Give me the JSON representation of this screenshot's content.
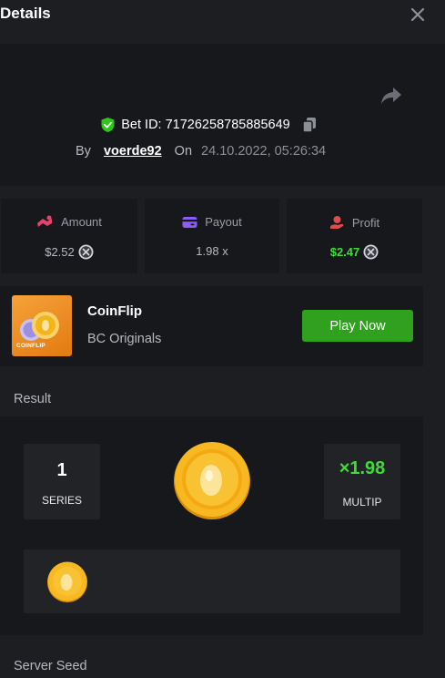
{
  "header": {
    "title": "Details",
    "close_icon": "close-icon"
  },
  "bet": {
    "id_label": "Bet ID: 71726258785885649",
    "by_label": "By",
    "username": "voerde92",
    "on_label": "On",
    "datetime": "24.10.2022, 05:26:34"
  },
  "stats": {
    "amount": {
      "label": "Amount",
      "value": "$2.52",
      "icon": "amount-icon",
      "color": "#e2456b"
    },
    "payout": {
      "label": "Payout",
      "value": "1.98 x",
      "icon": "wallet-icon",
      "color": "#8b5cf6"
    },
    "profit": {
      "label": "Profit",
      "value": "$2.47",
      "icon": "profit-icon",
      "color": "#e24b4b",
      "value_color": "#3fdc3a"
    }
  },
  "game": {
    "thumbnail_label": "COINFLIP",
    "name": "CoinFlip",
    "provider": "BC Originals",
    "play_label": "Play Now",
    "play_color": "#2fa11e"
  },
  "result": {
    "section_label": "Result",
    "series_value": "1",
    "series_label": "SERIES",
    "multip_value": "×1.98",
    "multip_label": "MULTIP",
    "multip_color": "#3fdc3a"
  },
  "server_seed": {
    "label": "Server Seed"
  }
}
